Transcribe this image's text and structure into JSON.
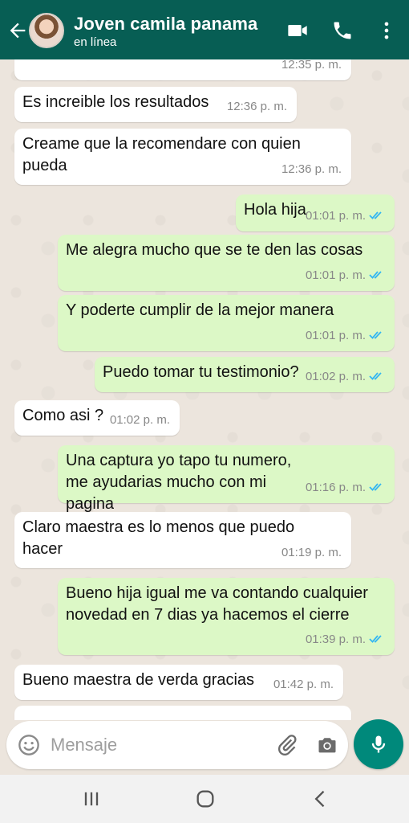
{
  "header": {
    "name": "Joven camila panama",
    "status": "en línea"
  },
  "messages": [
    {
      "dir": "in",
      "text": "",
      "time": "12:35 p. m."
    },
    {
      "dir": "in",
      "text": "Es increible los resultados",
      "time": "12:36 p. m."
    },
    {
      "dir": "in",
      "text": "Creame que la recomendare con quien pueda",
      "time": "12:36 p. m."
    },
    {
      "dir": "out",
      "text": "Hola hija",
      "time": "01:01 p. m."
    },
    {
      "dir": "out",
      "text": "Me alegra mucho que se te den las cosas",
      "time": "01:01 p. m."
    },
    {
      "dir": "out",
      "text": "Y poderte cumplir de la mejor manera",
      "time": "01:01 p. m."
    },
    {
      "dir": "out",
      "text": "Puedo tomar tu testimonio?",
      "time": "01:02 p. m."
    },
    {
      "dir": "in",
      "text": "Como asi ?",
      "time": "01:02 p. m."
    },
    {
      "dir": "out",
      "text": "Una captura yo tapo tu numero, me ayudarias mucho con mi pagina",
      "time": "01:16 p. m."
    },
    {
      "dir": "in",
      "text": "Claro maestra es lo menos que puedo hacer",
      "time": "01:19 p. m."
    },
    {
      "dir": "out",
      "text": "Bueno hija igual me va contando cualquier novedad en 7 dias ya hacemos el cierre",
      "time": "01:39 p. m."
    },
    {
      "dir": "in",
      "text": "Bueno maestra de verda gracias",
      "time": "01:42 p. m."
    }
  ],
  "composer": {
    "placeholder": "Mensaje"
  },
  "colors": {
    "header": "#075e54",
    "outgoing_bubble": "#dcf8c6",
    "incoming_bubble": "#ffffff",
    "read_ticks": "#34b7f1",
    "mic_button": "#00897b"
  },
  "icons": [
    "back-arrow-icon",
    "video-call-icon",
    "phone-icon",
    "more-vert-icon",
    "emoji-icon",
    "attach-icon",
    "camera-icon",
    "mic-icon",
    "recents-icon",
    "home-icon",
    "nav-back-icon",
    "double-check-icon"
  ]
}
